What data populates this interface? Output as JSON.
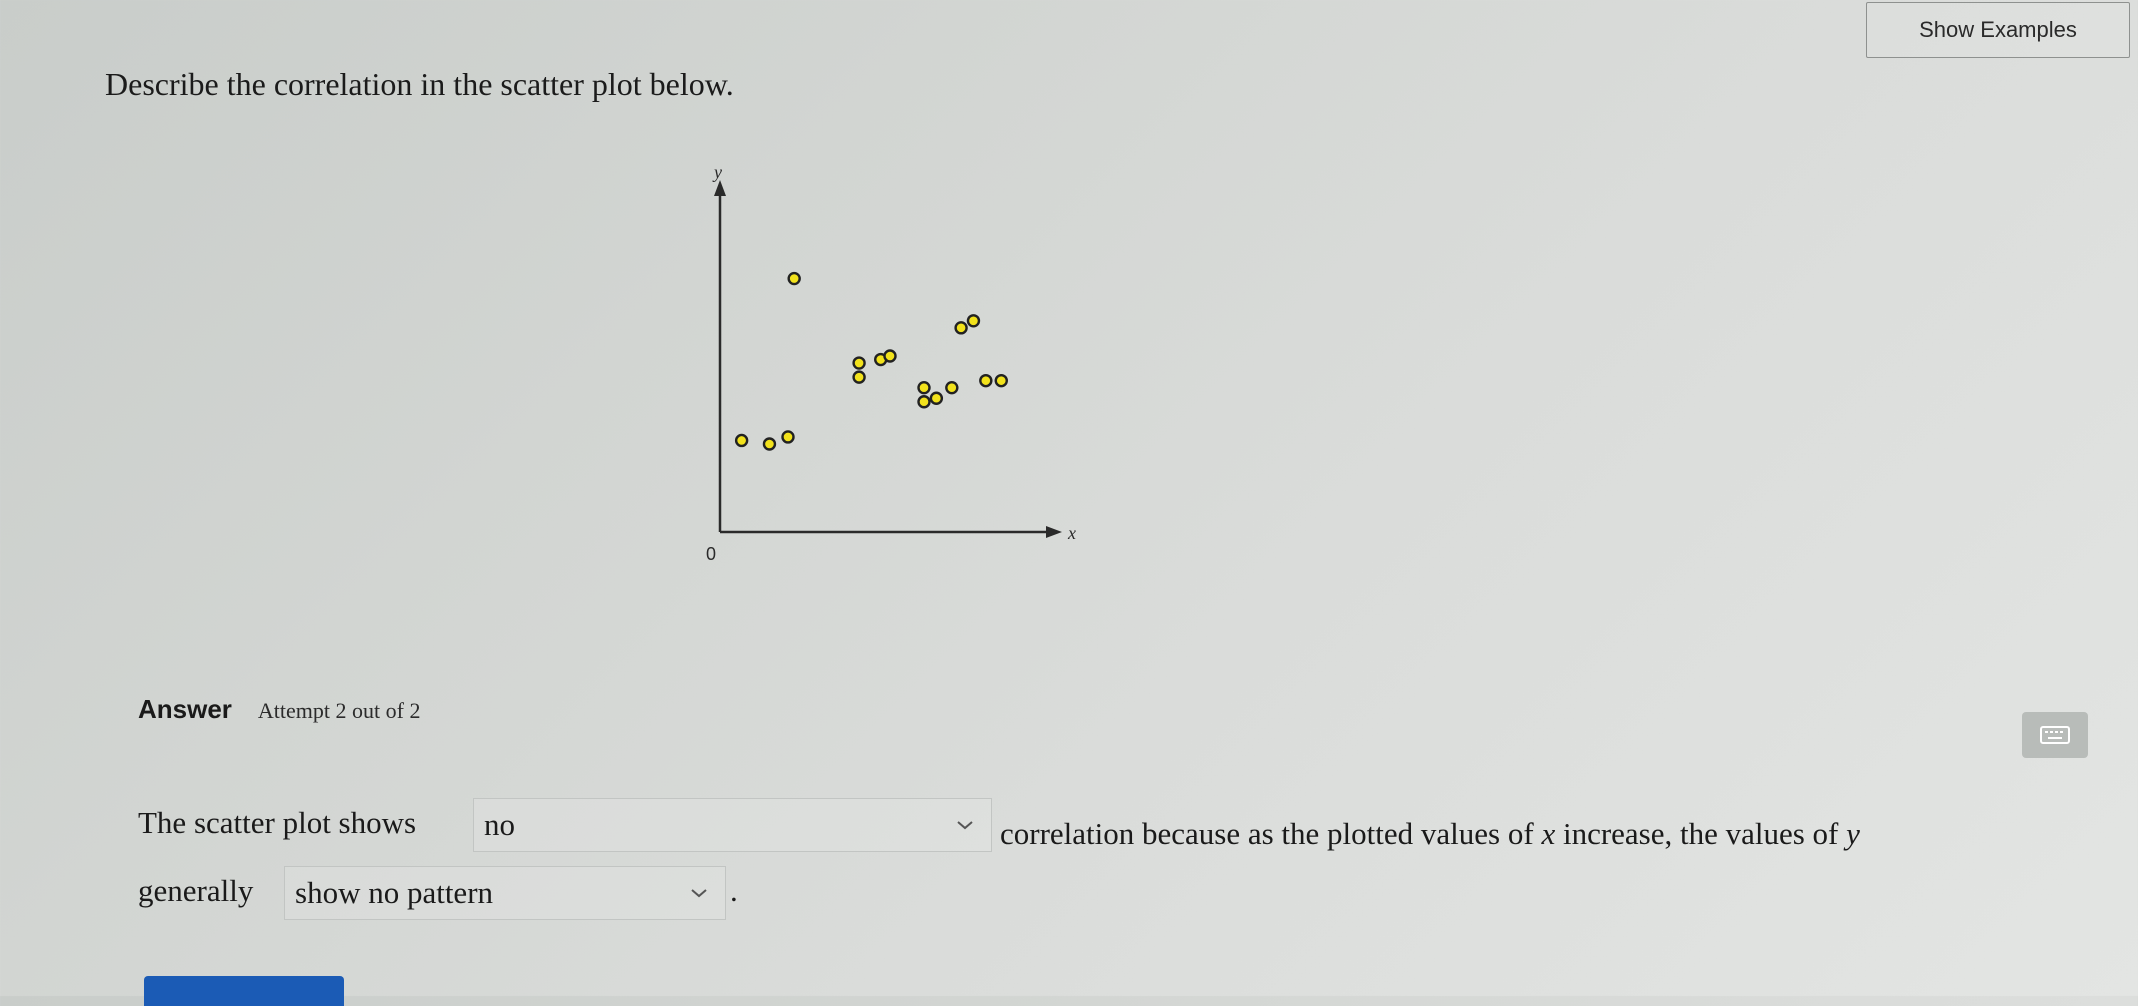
{
  "header": {
    "show_examples_label": "Show Examples"
  },
  "question": {
    "prompt": "Describe the correlation in the scatter plot below."
  },
  "chart_data": {
    "type": "scatter",
    "xlabel": "x",
    "ylabel": "y",
    "origin_label": "0",
    "grid": false,
    "points": [
      {
        "x": 0.7,
        "y": 2.6
      },
      {
        "x": 1.6,
        "y": 2.5
      },
      {
        "x": 2.2,
        "y": 2.7
      },
      {
        "x": 2.4,
        "y": 7.2
      },
      {
        "x": 4.5,
        "y": 4.4
      },
      {
        "x": 4.5,
        "y": 4.8
      },
      {
        "x": 5.2,
        "y": 4.9
      },
      {
        "x": 5.5,
        "y": 5.0
      },
      {
        "x": 6.6,
        "y": 3.7
      },
      {
        "x": 6.6,
        "y": 4.1
      },
      {
        "x": 7.0,
        "y": 3.8
      },
      {
        "x": 7.5,
        "y": 4.1
      },
      {
        "x": 7.8,
        "y": 5.8
      },
      {
        "x": 8.2,
        "y": 6.0
      },
      {
        "x": 8.6,
        "y": 4.3
      },
      {
        "x": 9.1,
        "y": 4.3
      }
    ],
    "xlim": [
      0,
      11
    ],
    "ylim": [
      0,
      10
    ],
    "marker_color": "#f2e21c"
  },
  "answer": {
    "label": "Answer",
    "attempt_text": "Attempt 2 out of 2",
    "sentence_part1": "The scatter plot shows",
    "correlation_select_value": "no",
    "sentence_part2": "correlation because as the plotted values of",
    "var_x": "x",
    "sentence_part3": "increase, the values of",
    "var_y": "y",
    "sentence_part4": "generally",
    "pattern_select_value": "show no pattern",
    "sentence_end": "."
  }
}
